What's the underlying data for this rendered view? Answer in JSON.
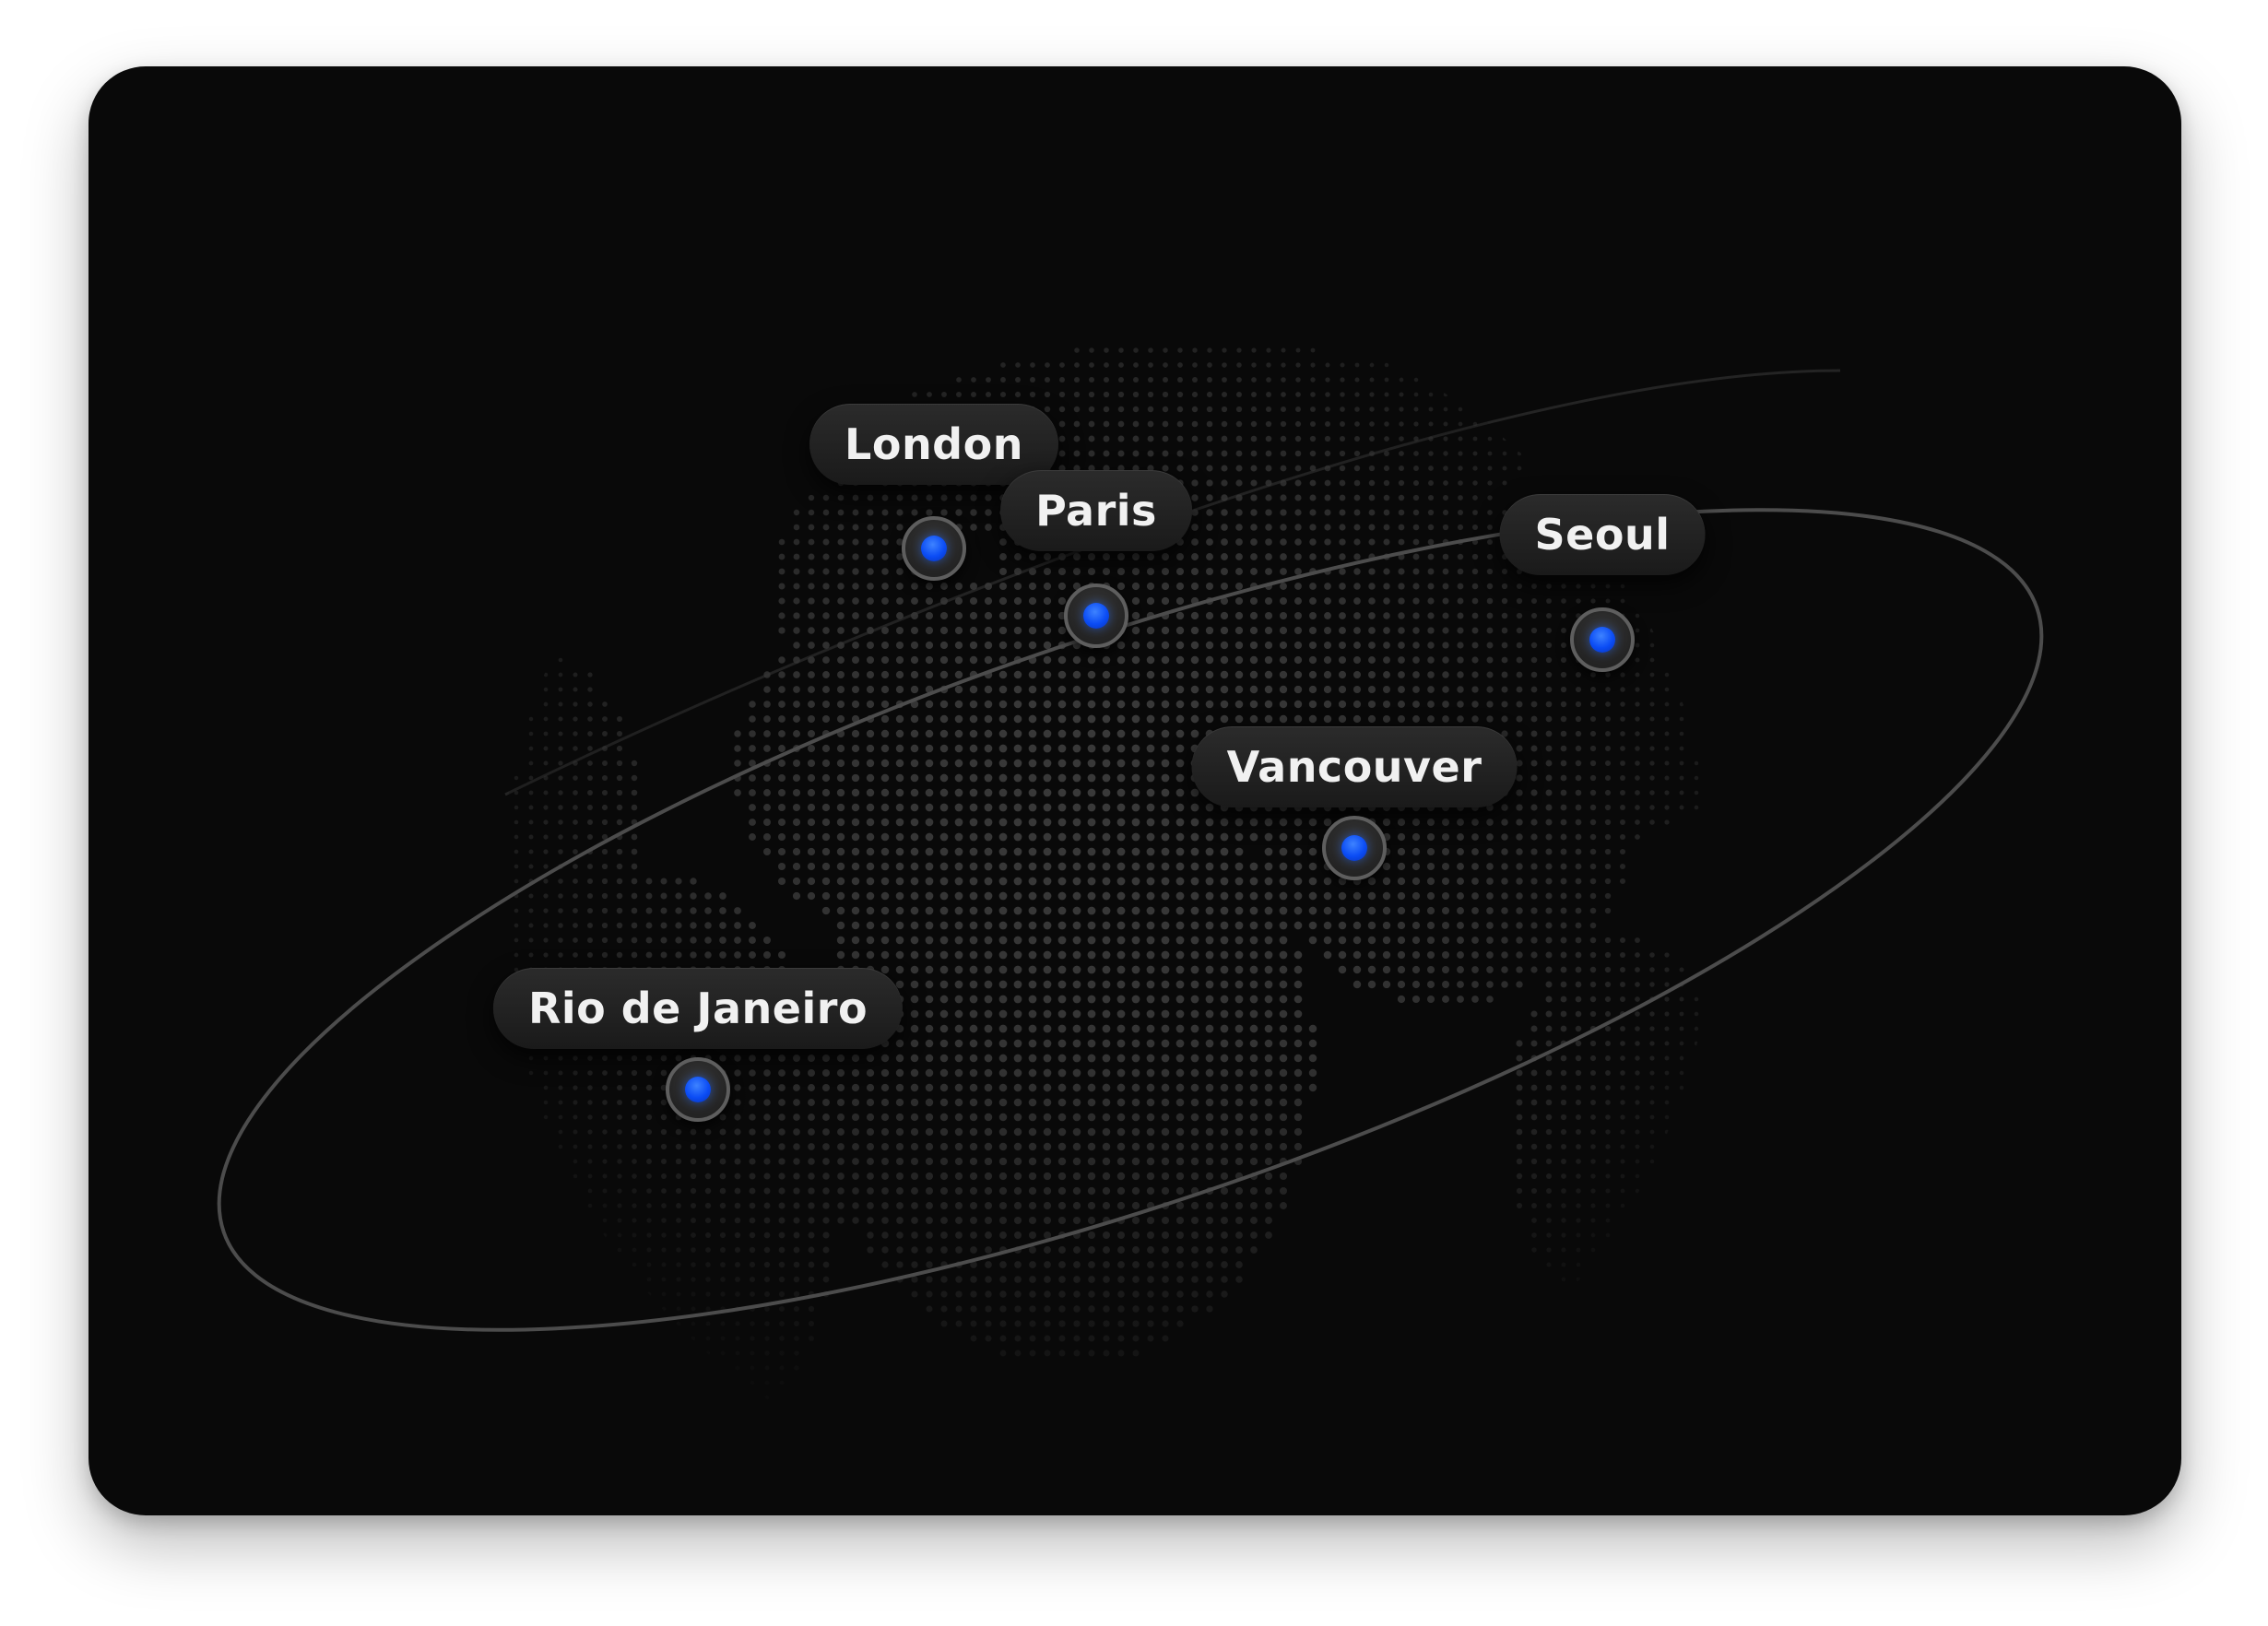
{
  "colors": {
    "background": "#ffffff",
    "card": "#090909",
    "globe_dots": "#3a3a3a",
    "orbit": "#5a5a5a",
    "label_bg": "#232323",
    "label_text": "#f1f1f1",
    "marker_dot": "#0b4cf5"
  },
  "globe": {
    "icon": "dotted-world-globe"
  },
  "locations": [
    {
      "id": "london",
      "label": "London"
    },
    {
      "id": "paris",
      "label": "Paris"
    },
    {
      "id": "seoul",
      "label": "Seoul"
    },
    {
      "id": "vancouver",
      "label": "Vancouver"
    },
    {
      "id": "rio",
      "label": "Rio de Janeiro"
    }
  ]
}
